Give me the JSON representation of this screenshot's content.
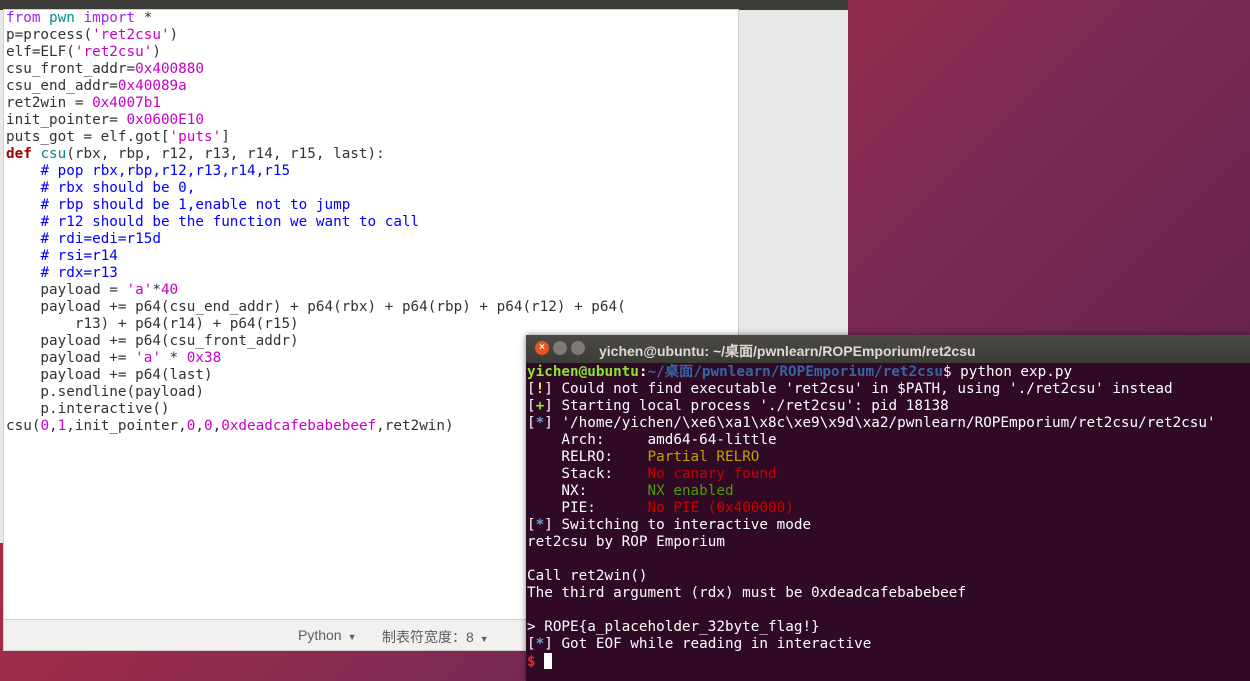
{
  "editor": {
    "status_language": "Python",
    "status_tab_width": "制表符宽度：8"
  },
  "terminal": {
    "title": "yichen@ubuntu: ~/桌面/pwnlearn/ROPEmporium/ret2csu",
    "prompt_user": "yichen@ubuntu",
    "prompt_path": "~/桌面/pwnlearn/ROPEmporium/ret2csu",
    "command": "python exp.py",
    "line_warn_tag": "!",
    "line_warn": "Could not find executable 'ret2csu' in $PATH, using './ret2csu' instead",
    "line_start_tag": "+",
    "line_start": "Starting local process './ret2csu': pid 18138",
    "line_path_tag": "*",
    "line_path": "'/home/yichen/\\xe6\\xa1\\x8c\\xe9\\x9d\\xa2/pwnlearn/ROPEmporium/ret2csu/ret2csu'",
    "arch_label": "    Arch:     ",
    "arch_value": "amd64-64-little",
    "relro_label": "    RELRO:    ",
    "relro_value": "Partial RELRO",
    "stack_label": "    Stack:    ",
    "stack_value": "No canary found",
    "nx_label": "    NX:       ",
    "nx_value": "NX enabled",
    "pie_label": "    PIE:      ",
    "pie_value": "No PIE (0x400000)",
    "line_switch_tag": "*",
    "line_switch": "Switching to interactive mode",
    "out1": "ret2csu by ROP Emporium",
    "out2": "",
    "out3": "Call ret2win()",
    "out4": "The third argument (rdx) must be 0xdeadcafebabebeef",
    "out5": "",
    "out6": "> ROPE{a_placeholder_32byte_flag!}",
    "line_eof_tag": "*",
    "line_eof": "Got EOF while reading in interactive",
    "final_prompt": "$"
  }
}
